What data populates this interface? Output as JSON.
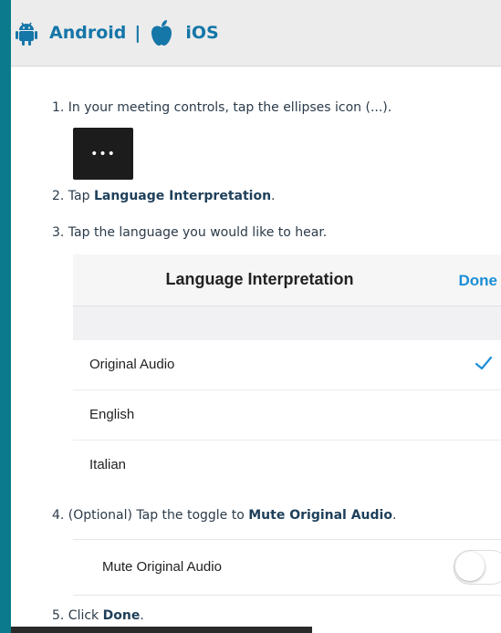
{
  "tabs": {
    "android_label": "Android",
    "separator": "|",
    "ios_label": "iOS",
    "android_icon": "android-icon",
    "ios_icon": "apple-icon",
    "accent": "#1576a8"
  },
  "steps": {
    "s1_prefix": "1. In your meeting controls, tap the ellipses icon (...).",
    "ellipsis_glyph": "•••",
    "s2_prefix": "2. Tap ",
    "s2_bold": "Language Interpretation",
    "s2_suffix": ".",
    "s3": "3. Tap the language you would like to hear.",
    "s4_prefix": "4. (Optional) Tap the toggle to ",
    "s4_bold": "Mute Original Audio",
    "s4_suffix": ".",
    "s5_prefix": "5. Click ",
    "s5_bold": "Done",
    "s5_suffix": "."
  },
  "sheet": {
    "title": "Language Interpretation",
    "done_label": "Done",
    "options": [
      {
        "label": "Original Audio",
        "selected": true
      },
      {
        "label": "English",
        "selected": false
      },
      {
        "label": "Italian",
        "selected": false
      }
    ],
    "check_color": "#1b8ed6"
  },
  "mute": {
    "label": "Mute Original Audio",
    "enabled": false
  }
}
